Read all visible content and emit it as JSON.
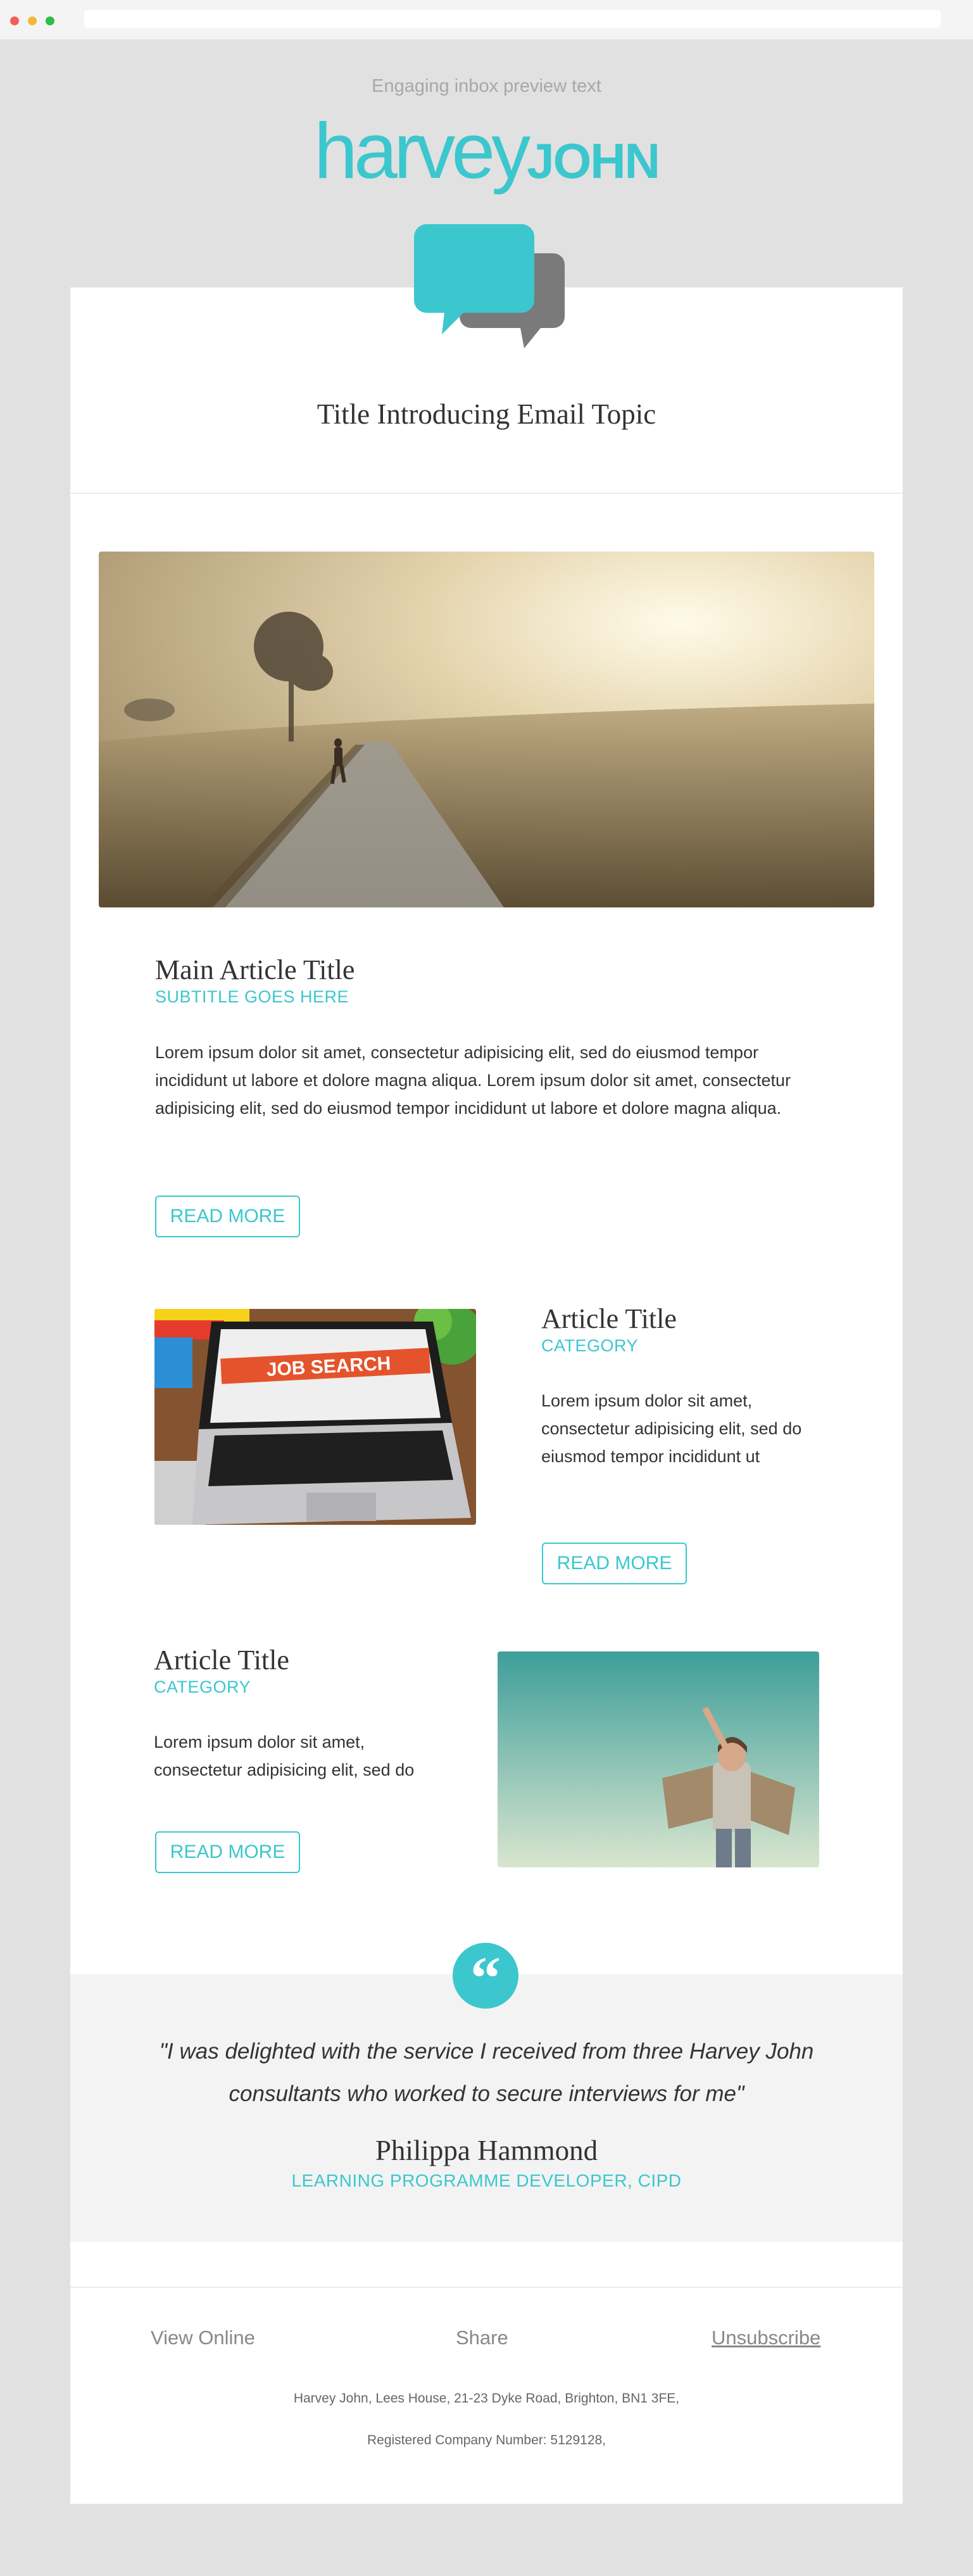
{
  "preview_text": "Engaging inbox preview text",
  "logo": {
    "lower": "harvey",
    "upper": "JOHN"
  },
  "header": {
    "title": "Title Introducing Email Topic"
  },
  "main_article": {
    "title": "Main Article Title",
    "subtitle": "SUBTITLE GOES HERE",
    "body": "Lorem ipsum dolor sit amet, consectetur adipisicing elit, sed do eiusmod tempor incididunt ut labore et dolore magna aliqua. Lorem ipsum dolor sit amet, consectetur adipisicing elit, sed do eiusmod tempor incididunt ut labore et dolore magna aliqua.",
    "button": "READ MORE"
  },
  "articles": [
    {
      "title": "Article Title",
      "category": "CATEGORY",
      "body": "Lorem ipsum dolor sit amet, consectetur adipisicing elit, sed do eiusmod tempor incididunt ut",
      "button": "READ MORE",
      "image_text": {
        "headline": "JOB SEARCH"
      }
    },
    {
      "title": "Article Title",
      "category": "CATEGORY",
      "body": "Lorem ipsum dolor sit amet, consectetur adipisicing elit, sed do",
      "button": "READ MORE"
    }
  ],
  "testimonial": {
    "quote_mark": "“",
    "quote": "\"I was delighted with the service I received from three Harvey John consultants who worked to secure interviews for me\"",
    "name": "Philippa Hammond",
    "role": "LEARNING PROGRAMME DEVELOPER, CIPD"
  },
  "footer": {
    "view_online": "View Online",
    "share": "Share",
    "unsubscribe": "Unsubscribe",
    "address": "Harvey John,  Lees House, 21-23 Dyke Road, Brighton, BN1 3FE,",
    "registered": "Registered Company Number: 5129128,"
  },
  "colors": {
    "accent": "#3bc7cd",
    "background": "#e1e1e1",
    "card": "#ffffff",
    "quote_band": "#f3f3f3",
    "icon_gray": "#7a7a7a"
  },
  "icons": [
    "chat-bubbles-icon",
    "quote-icon"
  ]
}
